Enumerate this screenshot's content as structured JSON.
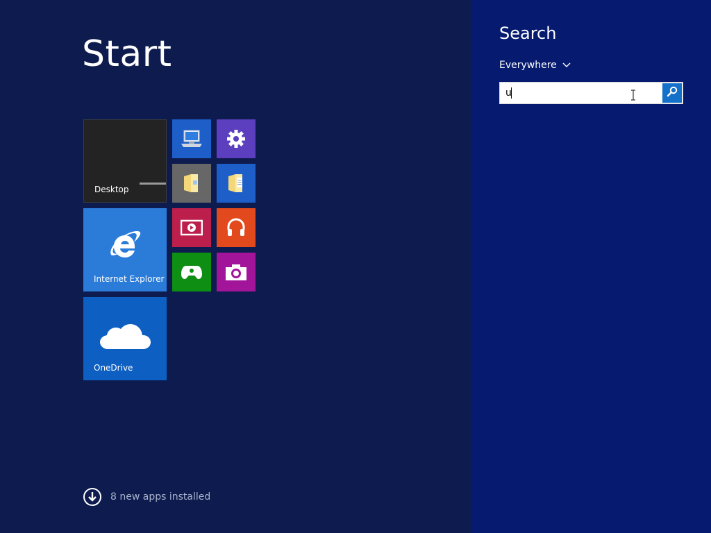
{
  "start": {
    "title": "Start",
    "new_apps_label": "8 new apps installed"
  },
  "tiles": {
    "desktop": {
      "label": "Desktop",
      "icon": "desktop-wallpaper-icon"
    },
    "internet_explorer": {
      "label": "Internet Explorer",
      "icon": "internet-explorer-icon"
    },
    "onedrive": {
      "label": "OneDrive",
      "icon": "cloud-icon"
    },
    "pc": {
      "icon": "computer-icon"
    },
    "settings": {
      "icon": "gear-icon"
    },
    "file_explorer": {
      "icon": "folder-icon"
    },
    "documents": {
      "icon": "documents-icon"
    },
    "video": {
      "icon": "video-icon"
    },
    "music": {
      "icon": "headphones-icon"
    },
    "games": {
      "icon": "game-controller-icon"
    },
    "camera": {
      "icon": "camera-icon"
    }
  },
  "search": {
    "title": "Search",
    "scope": "Everywhere",
    "query": "u"
  },
  "colors": {
    "start_background": "#0d1b4e",
    "search_pane_background": "#061b70",
    "ie_tile": "#2b7cd9",
    "onedrive_tile": "#0d5fc2",
    "settings_tile": "#5b3fbf",
    "video_tile": "#bd1f4c",
    "music_tile": "#e2491c",
    "games_tile": "#0e8e12",
    "camera_tile": "#a2149a"
  }
}
